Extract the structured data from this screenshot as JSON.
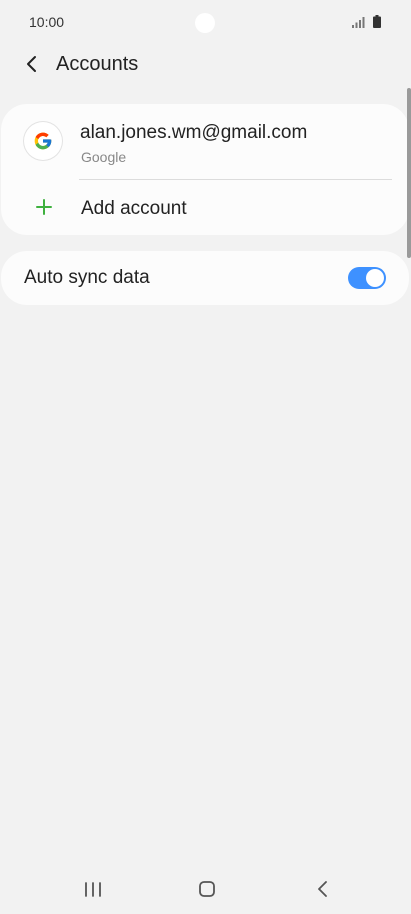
{
  "status_bar": {
    "time": "10:00",
    "icons": [
      "camera-cutout",
      "signal-icon",
      "battery-icon"
    ]
  },
  "header": {
    "title": "Accounts",
    "back_icon": "chevron-left-icon"
  },
  "accounts": {
    "items": [
      {
        "email": "alan.jones.wm@gmail.com",
        "provider": "Google",
        "icon": "google-logo"
      }
    ],
    "add_label": "Add account",
    "add_icon": "plus-icon"
  },
  "settings": {
    "auto_sync_label": "Auto sync data",
    "auto_sync_enabled": true
  },
  "nav_bar": {
    "buttons": [
      "recents-icon",
      "home-icon",
      "back-icon"
    ]
  },
  "colors": {
    "background": "#f2f2f2",
    "card": "#fcfcfc",
    "toggle_on": "#3e91ff",
    "plus": "#3fb13f"
  }
}
